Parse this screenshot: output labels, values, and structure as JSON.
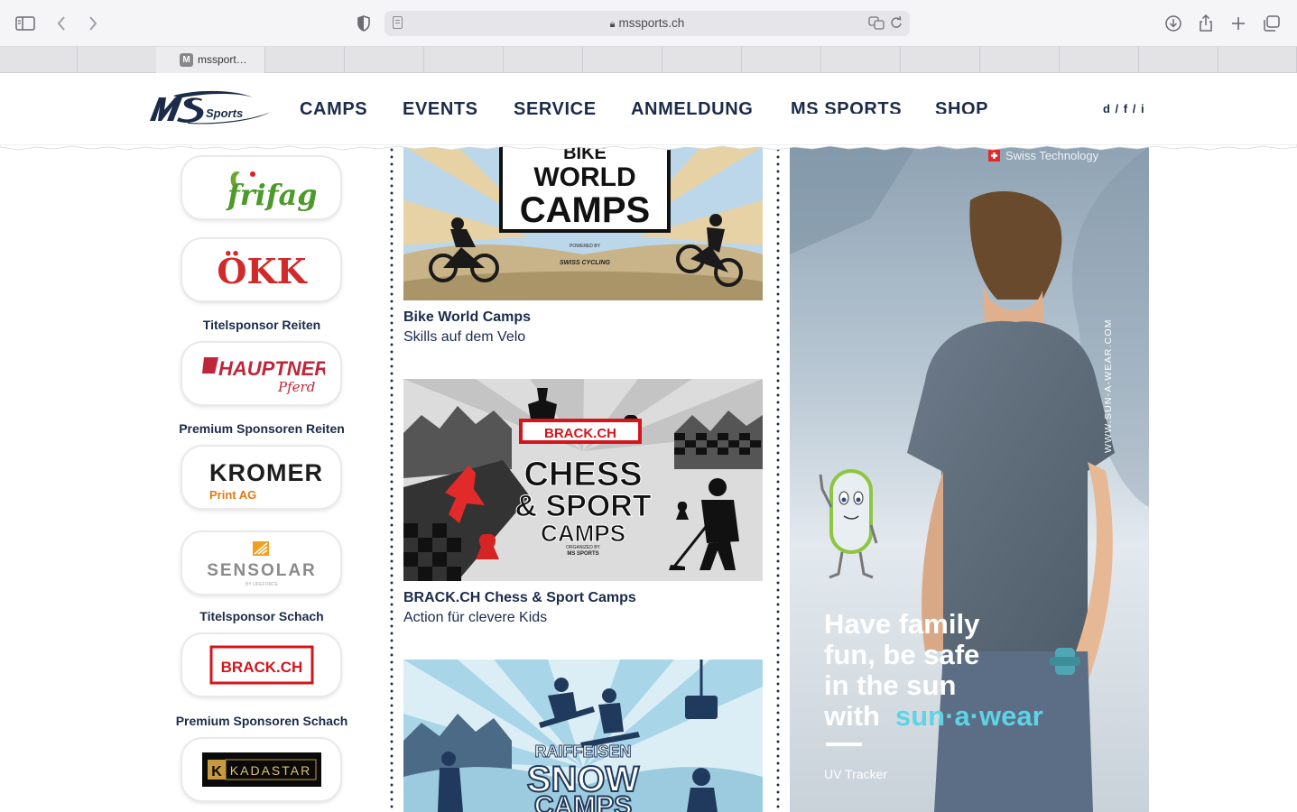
{
  "browser": {
    "url": "mssports.ch",
    "tab_title": "mssport…",
    "tab_favicon": "M"
  },
  "header": {
    "nav": [
      "CAMPS",
      "EVENTS",
      "SERVICE",
      "ANMELDUNG",
      "MS SPORTS",
      "SHOP"
    ],
    "lang": "d / f / i",
    "logo_text": "Sports"
  },
  "sponsors": {
    "logos": [
      "frifag",
      "ÖKK",
      "HAUPTNER",
      "Pferd",
      "KROMER",
      "Print AG",
      "SENSOLAR",
      "BY LIFEFORCE",
      "BRACK.CH",
      "KADASTAR"
    ],
    "captions": [
      "Titelsponsor Reiten",
      "Premium Sponsoren Reiten",
      "Titelsponsor Schach",
      "Premium Sponsoren Schach"
    ]
  },
  "camps": [
    {
      "title": "Bike World Camps",
      "subtitle": "Skills auf dem Velo",
      "art": [
        "BIKE",
        "WORLD",
        "CAMPS",
        "POWERED BY",
        "SWISS CYCLING"
      ]
    },
    {
      "title": "BRACK.CH Chess & Sport Camps",
      "subtitle": "Action für clevere Kids",
      "art": [
        "BRACK.CH",
        "CHESS",
        "& SPORT",
        "CAMPS",
        "ORGANIZED BY",
        "MS SPORTS"
      ]
    },
    {
      "art": [
        "RAIFFEISEN",
        "SNOW",
        "CAMPS"
      ]
    }
  ],
  "ad": {
    "badge": "Swiss Technology",
    "side_text": "WWW.SUN-A-WEAR.COM",
    "headline": [
      "Have family",
      "fun, be safe",
      "in the sun",
      "with"
    ],
    "brand": "sun·a·wear",
    "footer": "UV Tracker"
  }
}
